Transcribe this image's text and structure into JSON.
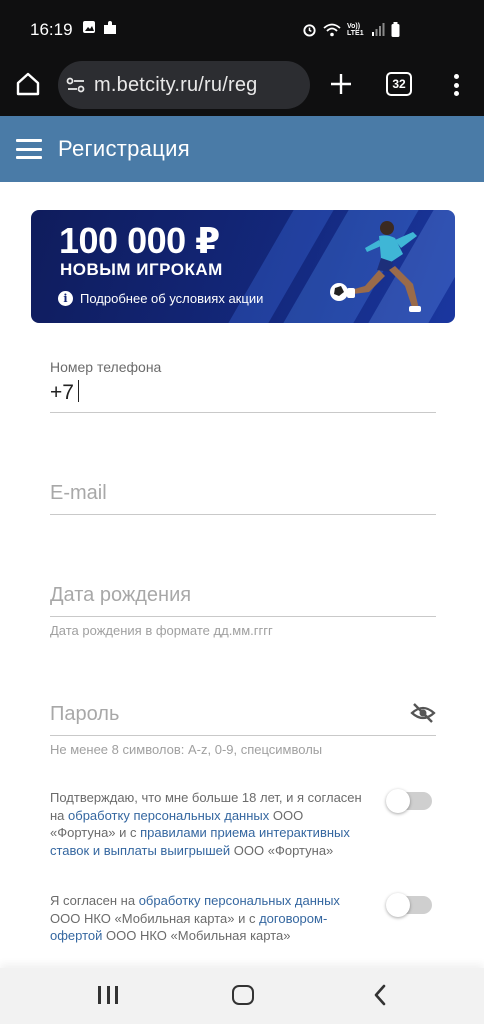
{
  "status_bar": {
    "time": "16:19",
    "network_label": "Vo)) LTE1"
  },
  "browser": {
    "url": "m.betcity.ru/ru/reg",
    "tab_count": "32"
  },
  "header": {
    "title": "Регистрация"
  },
  "banner": {
    "amount": "100 000 ₽",
    "subtitle": "НОВЫМ ИГРОКАМ",
    "info_text": "Подробнее об условиях акции"
  },
  "form": {
    "phone": {
      "label": "Номер телефона",
      "value": "+7"
    },
    "email": {
      "placeholder": "E-mail"
    },
    "birthdate": {
      "placeholder": "Дата рождения",
      "hint": "Дата рождения в формате дд.мм.гггг"
    },
    "password": {
      "placeholder": "Пароль",
      "hint": "Не менее 8 символов: A-z, 0-9, спецсимволы"
    }
  },
  "consents": [
    {
      "part1": "Подтверждаю, что мне больше 18 лет, и я согласен на ",
      "link1": "обработку персональных данных",
      "part2": " ООО «Фортуна» и с ",
      "link2": "правилами приема интерактивных ставок и выплаты выигрышей",
      "part3": " ООО «Фортуна»",
      "checked": false
    },
    {
      "part1": "Я согласен на ",
      "link1": "обработку персональных данных",
      "part2": " ООО НКО «Мобильная карта» и с ",
      "link2": "договором-офертой",
      "part3": " ООО НКО «Мобильная карта»",
      "checked": false
    }
  ],
  "colors": {
    "header_bg": "#4a7ba7",
    "banner_bg": "#13277a",
    "link": "#3567a0"
  }
}
